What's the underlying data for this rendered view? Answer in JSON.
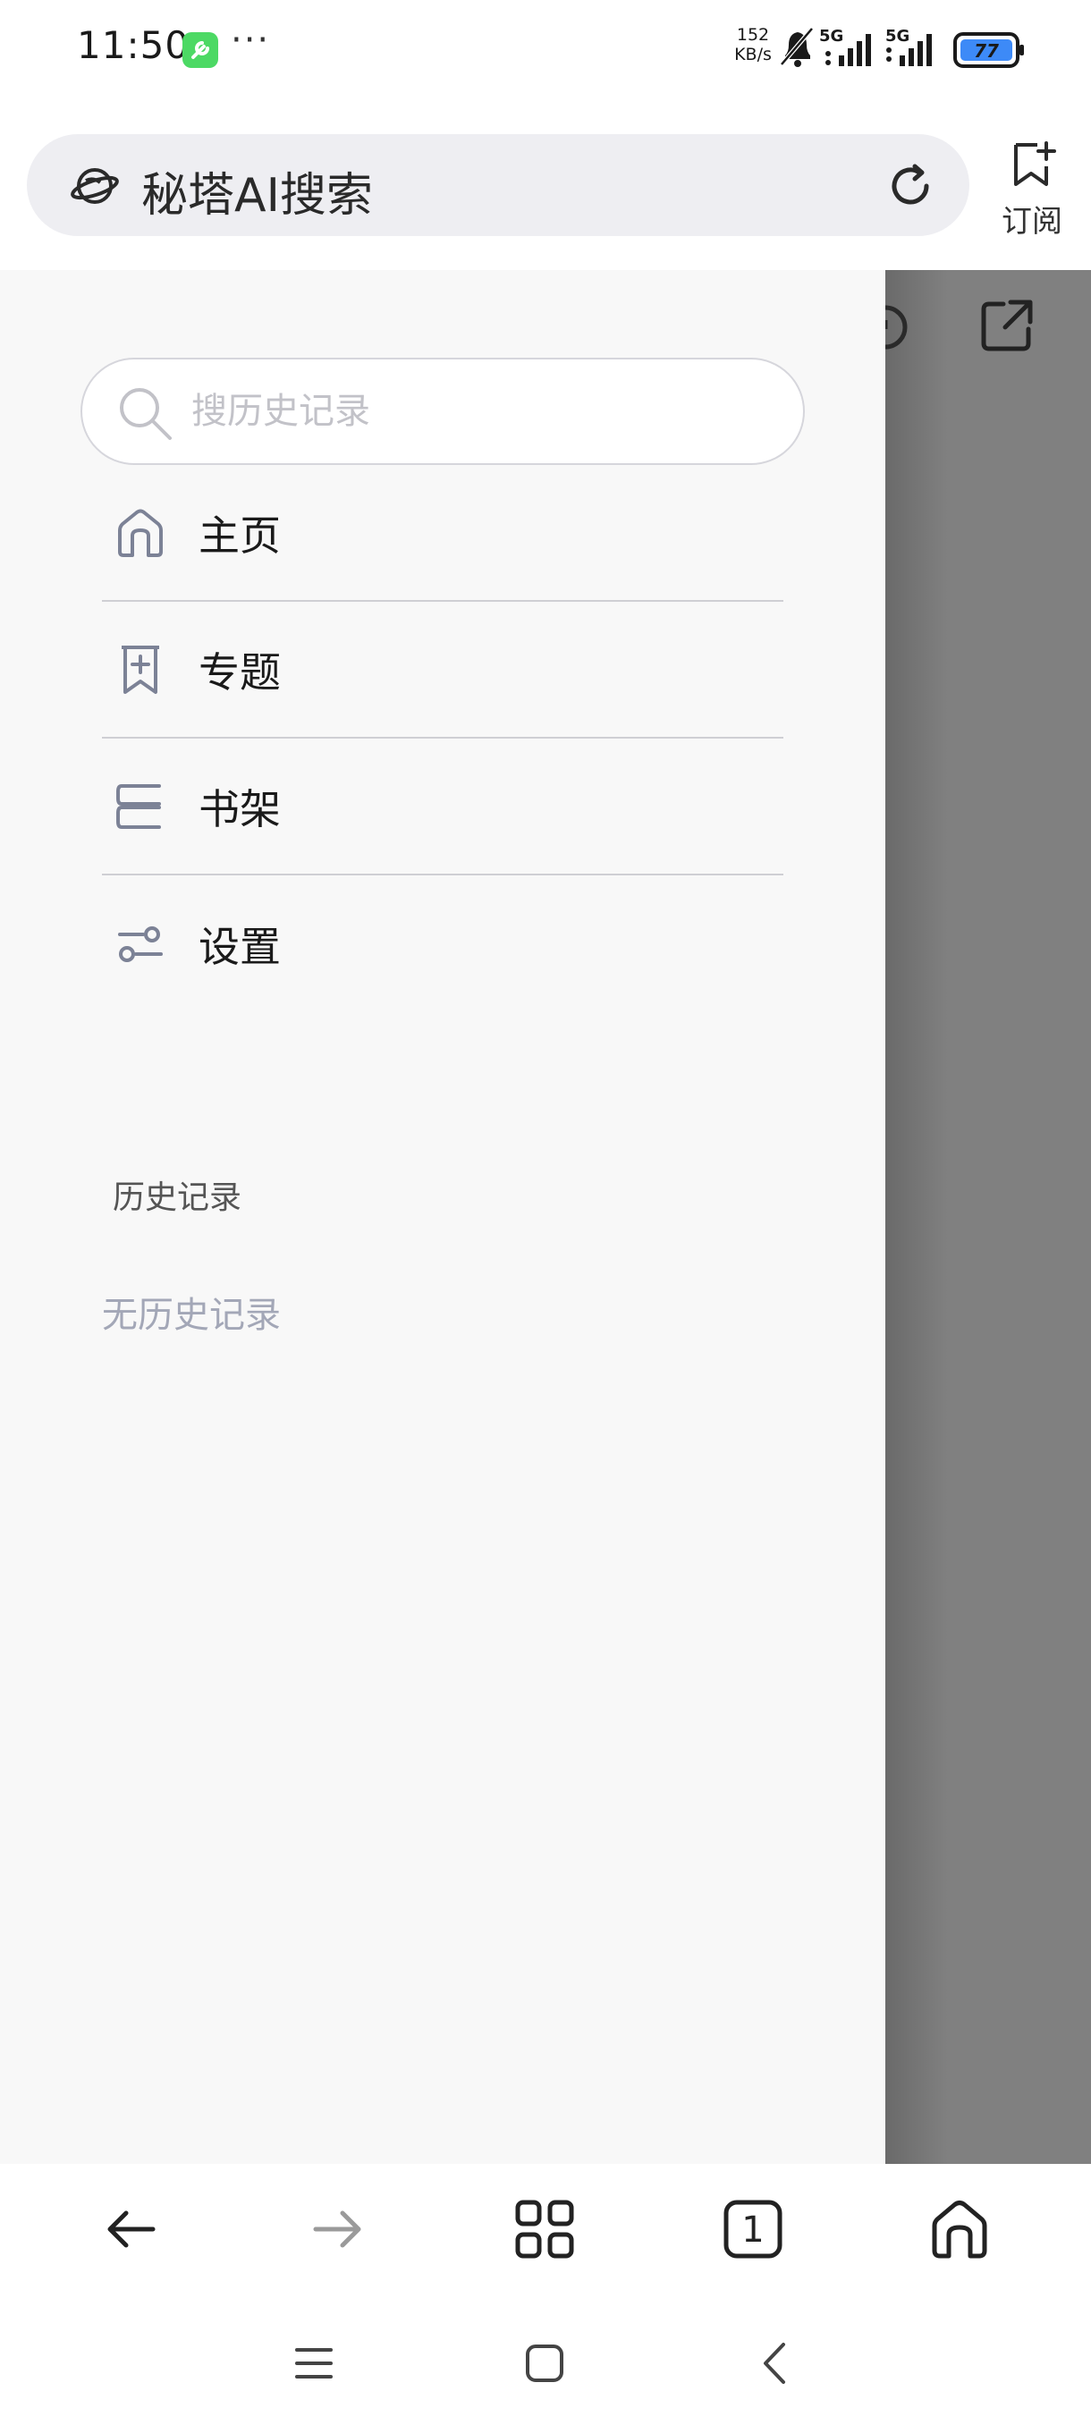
{
  "status": {
    "time": "11:50",
    "more": "···",
    "net_speed_value": "152",
    "net_speed_unit": "KB/s",
    "sim1": "5G",
    "sim2": "5G",
    "battery": "77"
  },
  "address_bar": {
    "title": "秘塔AI搜索",
    "subscribe_label": "订阅"
  },
  "drawer": {
    "search_placeholder": "搜历史记录",
    "menu": [
      {
        "label": "主页",
        "icon": "home-icon"
      },
      {
        "label": "专题",
        "icon": "bookmark-plus-icon"
      },
      {
        "label": "书架",
        "icon": "bookshelf-icon"
      },
      {
        "label": "设置",
        "icon": "settings-sliders-icon"
      }
    ],
    "history_title": "历史记录",
    "history_empty": "无历史记录"
  },
  "toolbar": {
    "tab_count": "1",
    "icons": [
      "back-arrow-icon",
      "forward-arrow-icon",
      "grid-menu-icon",
      "tabs-icon",
      "home-icon"
    ]
  },
  "system_nav": {
    "icons": [
      "recents-icon",
      "home-square-icon",
      "back-chevron-icon"
    ]
  },
  "colors": {
    "drawer_bg": "#f8f8f8",
    "overlay": "#808080",
    "address_bg": "#eeeef2",
    "icon_gray": "#7c8296",
    "battery_fill": "#3d8af7",
    "app_icon": "#4cd964"
  }
}
